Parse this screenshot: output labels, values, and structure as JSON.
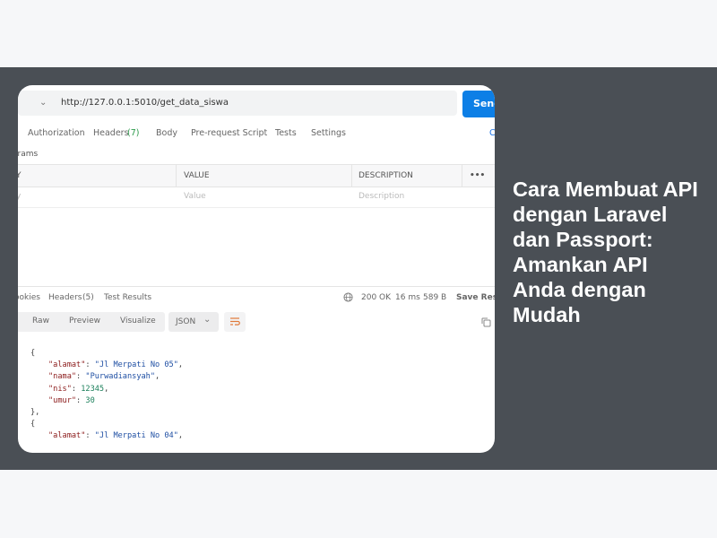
{
  "headline": "Cara Membuat API dengan Laravel dan Passport: Amankan API Anda dengan Mudah",
  "request": {
    "url": "http://127.0.0.1:5010/get_data_siswa",
    "send_label": "Send",
    "tabs": [
      "Authorization",
      "Headers",
      "(7)",
      "Body",
      "Pre-request Script",
      "Tests",
      "Settings"
    ],
    "right_link": "C"
  },
  "params": {
    "section_label": "arams",
    "columns": [
      "Y",
      "VALUE",
      "DESCRIPTION"
    ],
    "more": "•••",
    "placeholders": [
      "y",
      "Value",
      "Description"
    ]
  },
  "response": {
    "tabs": [
      "ookies",
      "Headers",
      "(5)",
      "Test Results"
    ],
    "status": "200 OK",
    "time": "16 ms",
    "size": "589 B",
    "save_label": "Save Resp",
    "format_tabs": [
      "Raw",
      "Preview",
      "Visualize"
    ],
    "format_select": "JSON",
    "json_lines": [
      {
        "t": "{"
      },
      {
        "k": "\"alamat\"",
        "v": "\"Jl Merpati No 05\"",
        "vt": "s"
      },
      {
        "k": "\"nama\"",
        "v": "\"Purwadiansyah\"",
        "vt": "s"
      },
      {
        "k": "\"nis\"",
        "v": "12345",
        "vt": "n"
      },
      {
        "k": "\"umur\"",
        "v": "30",
        "vt": "n",
        "last": true
      },
      {
        "t": "},"
      },
      {
        "t": "{"
      },
      {
        "k": "\"alamat\"",
        "v": "\"Jl Merpati No 04\"",
        "vt": "s"
      }
    ]
  },
  "colors": {
    "band": "#4a4f55",
    "send": "#0d7fe6",
    "status_green": "#2b9a4a"
  }
}
